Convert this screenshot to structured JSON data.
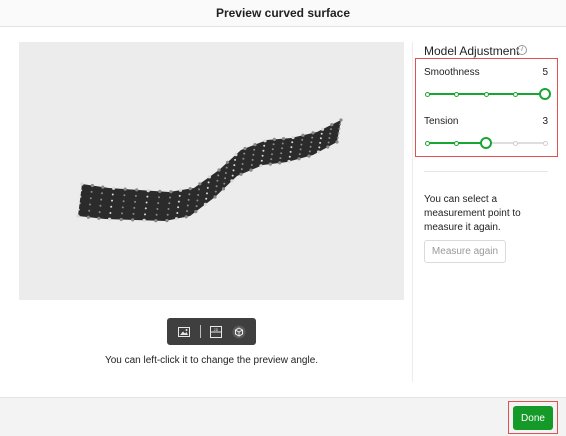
{
  "window": {
    "title": "Preview curved surface"
  },
  "preview": {
    "hint": "You can left-click it to change the preview angle.",
    "toolbar": {
      "tools": [
        {
          "name": "image-view-icon"
        },
        {
          "name": "flat-view-icon"
        },
        {
          "name": "3d-view-icon",
          "active": true
        }
      ]
    }
  },
  "panel": {
    "title": "Model Adjustment",
    "info_icon": "info-icon",
    "smoothness": {
      "label": "Smoothness",
      "value": "5",
      "level": 5,
      "max": 5
    },
    "tension": {
      "label": "Tension",
      "value": "3",
      "level": 3,
      "max": 5
    },
    "description": "You can select a measurement point to measure it again.",
    "measure_button": "Measure again"
  },
  "footer": {
    "done_label": "Done"
  },
  "colors": {
    "accent": "#19a532",
    "done": "#159a2a",
    "highlight": "#e05252"
  }
}
